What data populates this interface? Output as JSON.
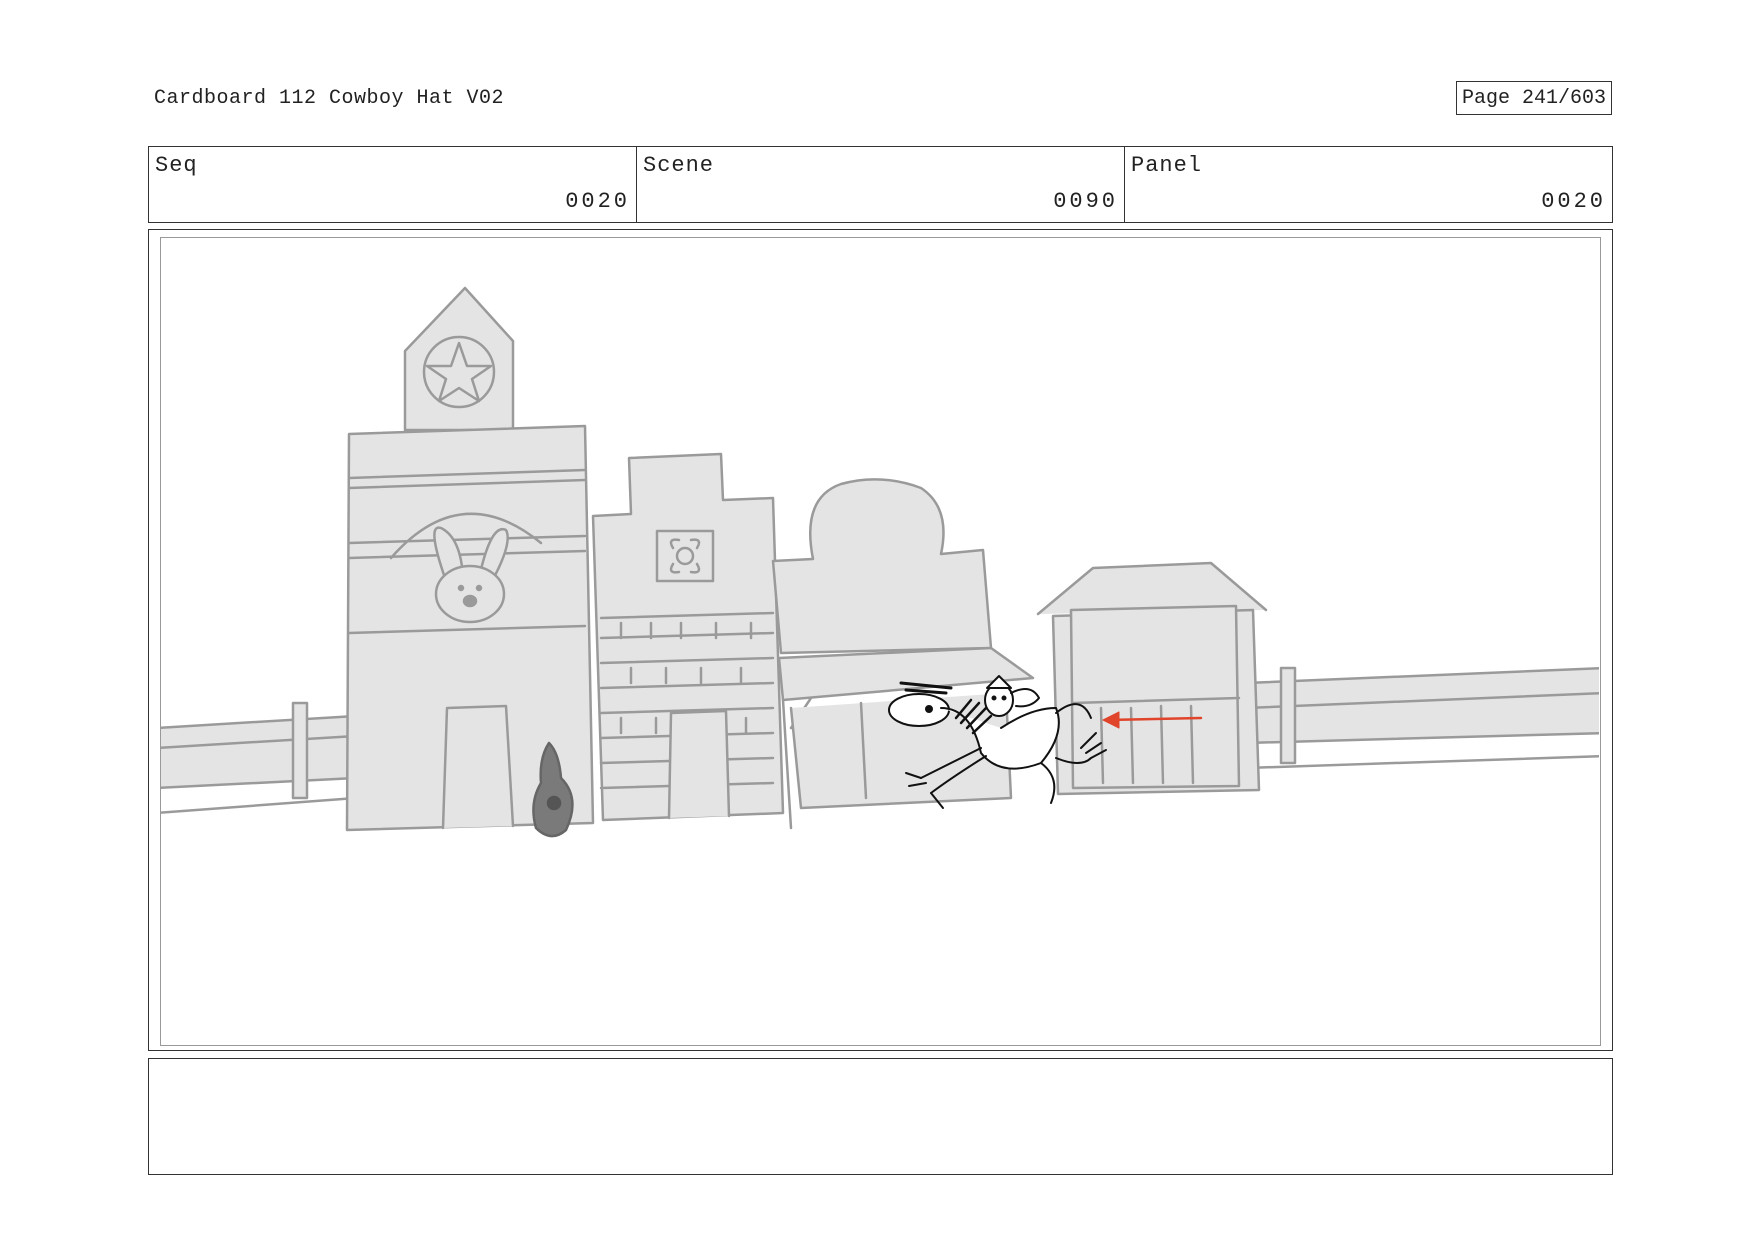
{
  "header": {
    "title": "Cardboard 112 Cowboy Hat V02",
    "page": "Page 241/603"
  },
  "info": {
    "seq_label": "Seq",
    "seq_value": "0020",
    "scene_label": "Scene",
    "scene_value": "0090",
    "panel_label": "Panel",
    "panel_value": "0020"
  },
  "panel": {
    "sketch_fill": "#e4e4e4",
    "sketch_line": "#9a9a9a",
    "arrow_color": "#e0442a"
  },
  "notes": {
    "text": ""
  }
}
